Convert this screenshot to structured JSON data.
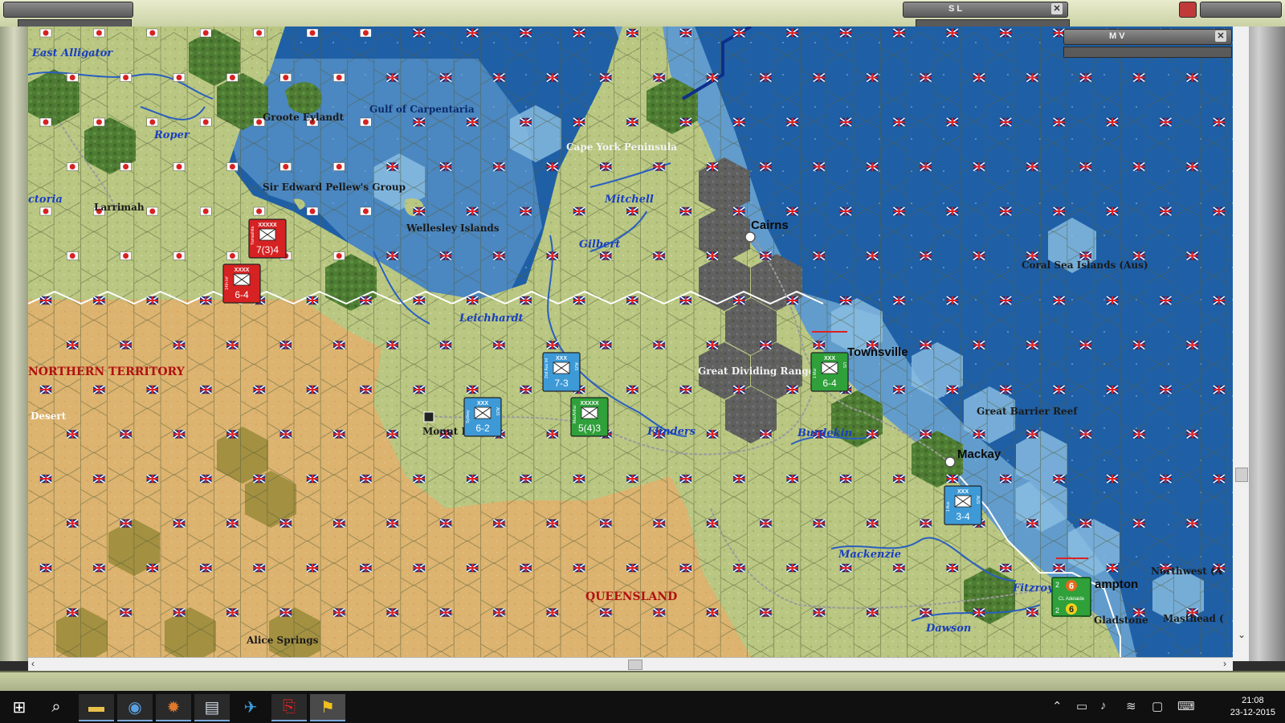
{
  "windows": {
    "sl_title": "S L",
    "mv_title": "M V"
  },
  "map_labels": {
    "east_alligator": "East Alligator",
    "roper": "Roper",
    "groote": "Groote Eylandt",
    "gulf": "Gulf of Carpentaria",
    "cape_york": "Cape York Peninsula",
    "victoria": "ctoria",
    "larrimah": "Larrimah",
    "pellew": "Sir Edward Pellew's Group",
    "wellesley": "Wellesley Islands",
    "mitchell": "Mitchell",
    "gilbert": "Gilbert",
    "cairns": "Cairns",
    "coral_sea": "Coral Sea Islands (Aus)",
    "leichhardt": "Leichhardt",
    "northern_territory": "NORTHERN TERRITORY",
    "townsville": "Townsville",
    "great_dividing": "Great Dividing Range",
    "desert": "Desert",
    "great_barrier": "Great Barrier Reef",
    "mount_isa": "Mount Isa",
    "flinders": "Flinders",
    "burdekin": "Burdekin",
    "mackay": "Mackay",
    "mackenzie": "Mackenzie",
    "northwest": "Northwest (A",
    "fitzroy": "Fitzroy",
    "rockhampton": "ampton",
    "queensland": "QUEENSLAND",
    "gladstone": "Gladstone",
    "masthead": "Masthead (",
    "dawson": "Dawson",
    "alice_springs": "Alice Springs"
  },
  "units": [
    {
      "id": "jp1",
      "side": "japan",
      "size": "XXXXX",
      "name": "Yamashita",
      "strength": "7(3)4"
    },
    {
      "id": "jp2",
      "side": "japan",
      "size": "XXXX",
      "name": "14th Inf",
      "strength": "6-4"
    },
    {
      "id": "au1",
      "side": "allied-blue",
      "size": "XXX",
      "name": "2nd Aus Inf",
      "strength": "7-3",
      "nation": "AUS"
    },
    {
      "id": "au2",
      "side": "allied-blue",
      "size": "XXX",
      "name": "Sydney",
      "strength": "6-2",
      "nation": "AUS"
    },
    {
      "id": "us1",
      "side": "allied-green",
      "size": "XXXXX",
      "name": "MacArthur",
      "strength": "5(4)3"
    },
    {
      "id": "us2",
      "side": "allied-green",
      "size": "XXX",
      "name": "1 Mar",
      "strength": "6-4",
      "nation": "US"
    },
    {
      "id": "au3",
      "side": "allied-blue",
      "size": "XXX",
      "name": "1 Aus",
      "strength": "3-4",
      "nation": "AUS"
    }
  ],
  "naval_unit": {
    "top": "6",
    "bottom": "6",
    "left_top": "2",
    "left_bottom": "2",
    "name": "CL Adelaide"
  },
  "taskbar": {
    "time": "21:08",
    "date": "23-12-2015",
    "apps": [
      "windows-logo",
      "search",
      "file-explorer",
      "browser",
      "game-launcher",
      "document-viewer",
      "flight-app",
      "pdf-reader",
      "mwif-game"
    ]
  },
  "colors": {
    "sea": "#1f5fa6",
    "coast": "#7fb6de",
    "grass": "#b9c782",
    "desert": "#dcb36f",
    "forest": "#4e7d33",
    "mountain": "#5a5a5a",
    "japan": "#d62222",
    "allied_blue": "#3d9ad6",
    "allied_green": "#2fa03a"
  }
}
